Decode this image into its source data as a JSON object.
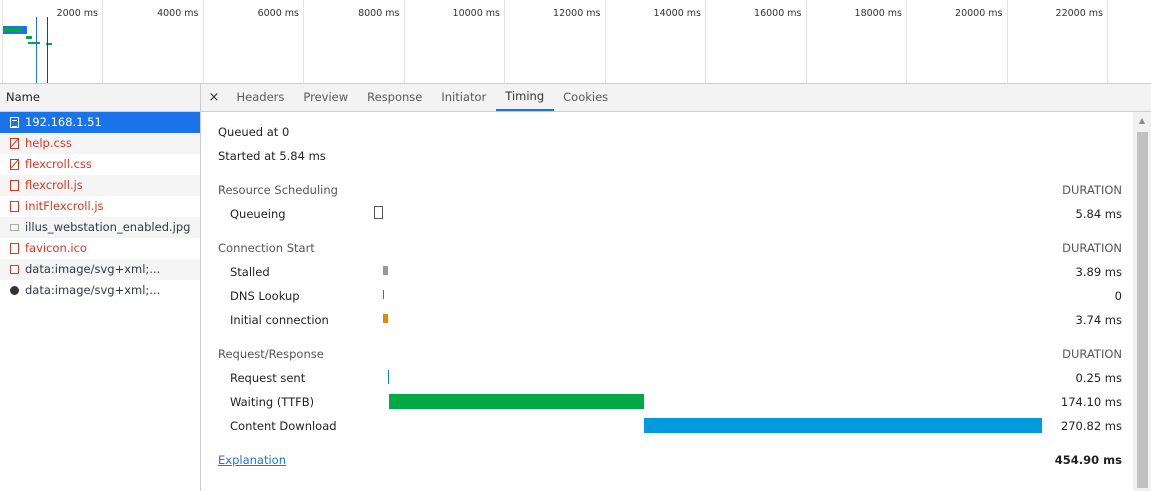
{
  "overview": {
    "ticks": [
      "2000 ms",
      "4000 ms",
      "6000 ms",
      "8000 ms",
      "10000 ms",
      "12000 ms",
      "14000 ms",
      "16000 ms",
      "18000 ms",
      "20000 ms",
      "22000 ms"
    ]
  },
  "requests": {
    "header": "Name",
    "items": [
      {
        "name": "192.168.1.51",
        "icon": "document-icon",
        "state": "selected"
      },
      {
        "name": "help.css",
        "icon": "css-file-icon",
        "state": "error"
      },
      {
        "name": "flexcroll.css",
        "icon": "css-file-icon",
        "state": "error"
      },
      {
        "name": "flexcroll.js",
        "icon": "js-file-icon",
        "state": "error"
      },
      {
        "name": "initFlexcroll.js",
        "icon": "js-file-icon",
        "state": "error"
      },
      {
        "name": "illus_webstation_enabled.jpg",
        "icon": "image-icon",
        "state": "normal"
      },
      {
        "name": "favicon.ico",
        "icon": "file-icon",
        "state": "error"
      },
      {
        "name": "data:image/svg+xml;...",
        "icon": "svg-image-icon",
        "state": "normal"
      },
      {
        "name": "data:image/svg+xml;...",
        "icon": "svg-image-icon",
        "state": "normal"
      }
    ]
  },
  "tabs": {
    "close": "×",
    "items": [
      "Headers",
      "Preview",
      "Response",
      "Initiator",
      "Timing",
      "Cookies"
    ],
    "active": "Timing"
  },
  "timing": {
    "queued_at": "Queued at 0",
    "started_at": "Started at 5.84 ms",
    "duration_label": "DURATION",
    "resource_scheduling": {
      "title": "Resource Scheduling",
      "rows": [
        {
          "label": "Queueing",
          "value": "5.84 ms"
        }
      ]
    },
    "connection_start": {
      "title": "Connection Start",
      "rows": [
        {
          "label": "Stalled",
          "value": "3.89 ms"
        },
        {
          "label": "DNS Lookup",
          "value": "0"
        },
        {
          "label": "Initial connection",
          "value": "3.74 ms"
        }
      ]
    },
    "request_response": {
      "title": "Request/Response",
      "rows": [
        {
          "label": "Request sent",
          "value": "0.25 ms"
        },
        {
          "label": "Waiting (TTFB)",
          "value": "174.10 ms"
        },
        {
          "label": "Content Download",
          "value": "270.82 ms"
        }
      ]
    },
    "explanation": "Explanation",
    "total": "454.90 ms",
    "colors": {
      "queueing": "#ffffff",
      "stalled": "#999999",
      "dns": "#009688",
      "connection": "#e08a00",
      "request_sent": "#009688",
      "waiting": "#00a846",
      "download": "#0299de"
    }
  }
}
